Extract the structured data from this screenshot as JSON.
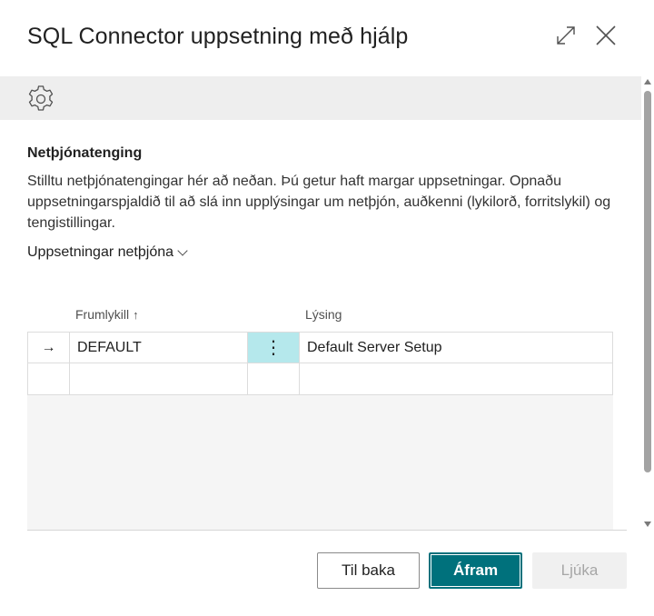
{
  "dialog": {
    "title": "SQL Connector uppsetning með hjálp",
    "expand_icon": "expand-icon",
    "close_icon": "close-icon"
  },
  "settings": {
    "icon": "gear-icon"
  },
  "section": {
    "title": "Netþjónatenging",
    "description": "Stilltu netþjónatengingar hér að neðan. Þú getur haft margar uppsetningar. Opnaðu uppsetningarspjaldið til að slá inn upplýsingar um netþjón, auðkenni (lykilorð, forritslykil) og tengistillingar.",
    "subpage_label": "Uppsetningar netþjóna"
  },
  "grid": {
    "columns": {
      "key": "Frumlykill",
      "sort_indicator": "↑",
      "description": "Lýsing"
    },
    "rows": [
      {
        "selector": "→",
        "key": "DEFAULT",
        "menu": "⋮",
        "description": "Default Server Setup"
      },
      {
        "selector": "",
        "key": "",
        "menu": "",
        "description": ""
      }
    ]
  },
  "footer": {
    "back_label": "Til baka",
    "next_label": "Áfram",
    "finish_label": "Ljúka"
  },
  "colors": {
    "primary": "#00717c",
    "selected_cell": "#b5e8ec",
    "settings_band": "#eeeeee"
  }
}
